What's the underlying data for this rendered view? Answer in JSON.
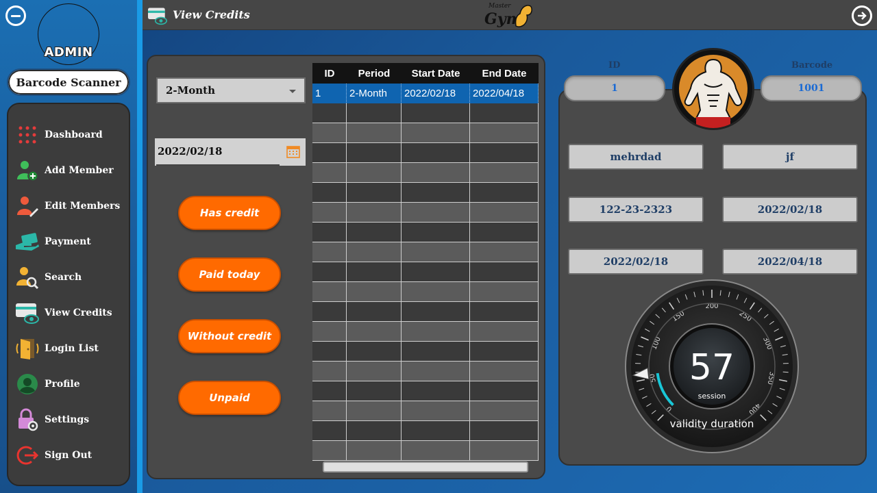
{
  "sidebar": {
    "admin_label": "ADMIN",
    "barcode_button": "Barcode Scanner",
    "items": [
      {
        "label": "Dashboard",
        "icon": "dashboard-grid-icon"
      },
      {
        "label": "Add Member",
        "icon": "add-user-icon"
      },
      {
        "label": "Edit Members",
        "icon": "edit-user-icon"
      },
      {
        "label": "Payment",
        "icon": "payment-hand-icon"
      },
      {
        "label": "Search",
        "icon": "search-user-icon"
      },
      {
        "label": "View Credits",
        "icon": "credit-card-eye-icon"
      },
      {
        "label": "Login List",
        "icon": "door-icon"
      },
      {
        "label": "Profile",
        "icon": "profile-icon"
      },
      {
        "label": "Settings",
        "icon": "lock-settings-icon"
      },
      {
        "label": "Sign Out",
        "icon": "sign-out-icon"
      }
    ]
  },
  "header": {
    "title": "View Credits",
    "logo_master": "Master",
    "logo_gym": "Gym"
  },
  "filters": {
    "period_selected": "2-Month",
    "date_value": "2022/02/18",
    "buttons": [
      "Has credit",
      "Paid today",
      "Without credit",
      "Unpaid"
    ]
  },
  "table": {
    "columns": [
      "ID",
      "Period",
      "Start Date",
      "End Date"
    ],
    "rows": [
      [
        "1",
        "2-Month",
        "2022/02/18",
        "2022/04/18"
      ]
    ]
  },
  "member": {
    "id_label": "ID",
    "id_value": "1",
    "barcode_label": "Barcode",
    "barcode_value": "1001",
    "first_name": "mehrdad",
    "last_name": "jf",
    "phone": "122-23-2323",
    "registered": "2022/02/18",
    "start_date": "2022/02/18",
    "end_date": "2022/04/18"
  },
  "gauge": {
    "value": "57",
    "unit": "session",
    "caption": "validity duration",
    "ticks": [
      "0",
      "50",
      "100",
      "150",
      "200",
      "250",
      "300",
      "350",
      "400"
    ]
  },
  "colors": {
    "accent_orange": "#ff6a00",
    "selection_blue": "#0f64b0",
    "field_text": "#1f3e66",
    "gauge_arc": "#19c6d6"
  }
}
